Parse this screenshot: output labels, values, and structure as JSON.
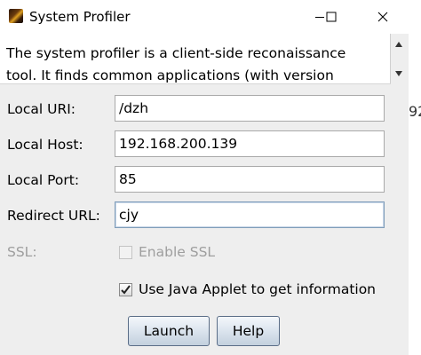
{
  "window": {
    "title": "System Profiler",
    "app_icon": "app-logo-icon",
    "controls": [
      "minimize-icon",
      "maximize-icon",
      "close-icon"
    ]
  },
  "description": {
    "text": "The system profiler is a client-side reconaissance\ntool. It finds common applications (with version"
  },
  "background_fragment": "92",
  "form": {
    "local_uri": {
      "label": "Local URI:",
      "value": "/dzh"
    },
    "local_host": {
      "label": "Local Host:",
      "value": "192.168.200.139"
    },
    "local_port": {
      "label": "Local Port:",
      "value": "85"
    },
    "redirect_url": {
      "label": "Redirect URL:",
      "value": "cjy"
    },
    "ssl": {
      "label": "SSL:",
      "checkbox_label": "Enable SSL",
      "checked": false,
      "enabled": false
    },
    "java_applet": {
      "checkbox_label": "Use Java Applet to get information",
      "checked": true
    }
  },
  "buttons": {
    "launch": "Launch",
    "help": "Help"
  },
  "colors": {
    "title_bar": "#ffffff",
    "dialog_bg": "#eeeeee",
    "disabled_text": "#9e9e9e",
    "focus_border": "#7f9db9",
    "button_border": "#5a6d87"
  }
}
